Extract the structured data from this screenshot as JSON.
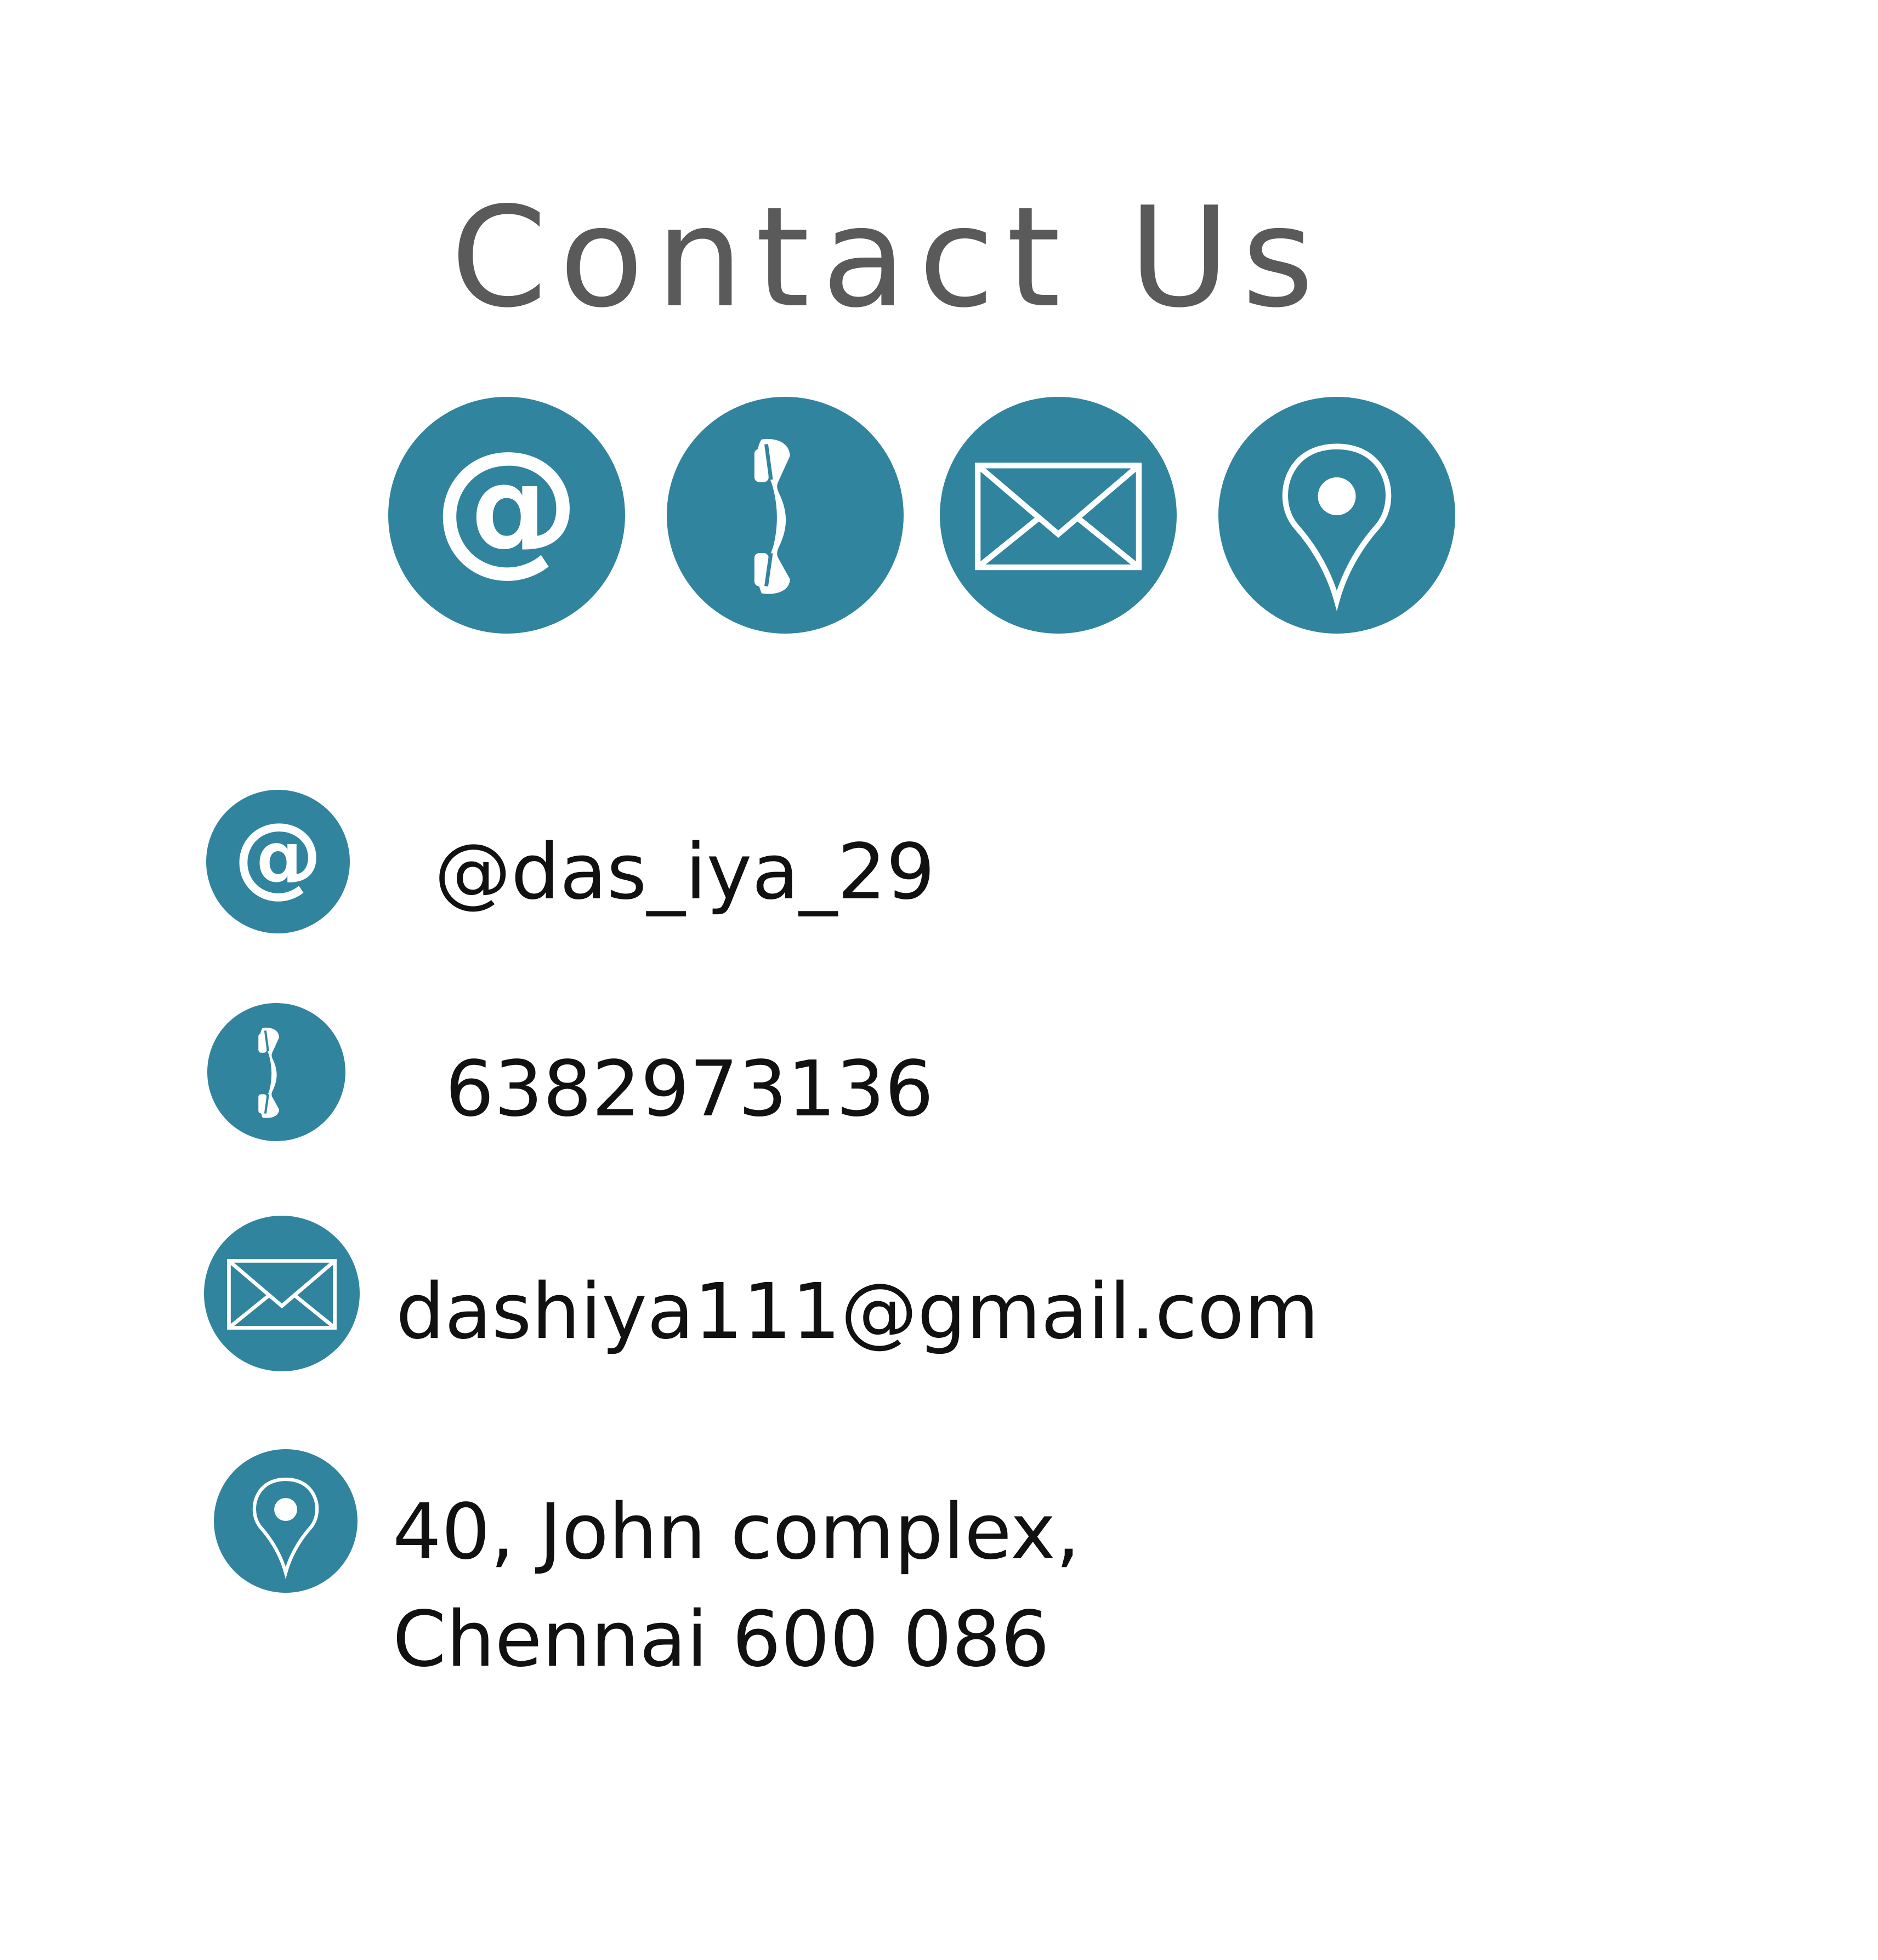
{
  "header": {
    "title": "Contact Us"
  },
  "theme": {
    "accent_color": "#31849e",
    "icon_foreground": "#ffffff",
    "title_color": "#5a5a5a",
    "text_color": "#111111",
    "background": "#ffffff"
  },
  "top_icons": [
    {
      "icon": "at-sign-icon"
    },
    {
      "icon": "phone-icon"
    },
    {
      "icon": "envelope-icon"
    },
    {
      "icon": "location-pin-icon"
    }
  ],
  "contacts": {
    "handle": {
      "icon": "at-sign-icon",
      "value": "@das_iya_29"
    },
    "phone": {
      "icon": "phone-icon",
      "value": "6382973136"
    },
    "email": {
      "icon": "envelope-icon",
      "value": "dashiya111@gmail.com"
    },
    "address": {
      "icon": "location-pin-icon",
      "line1": "40, John complex,",
      "line2": "Chennai 600 086"
    }
  }
}
